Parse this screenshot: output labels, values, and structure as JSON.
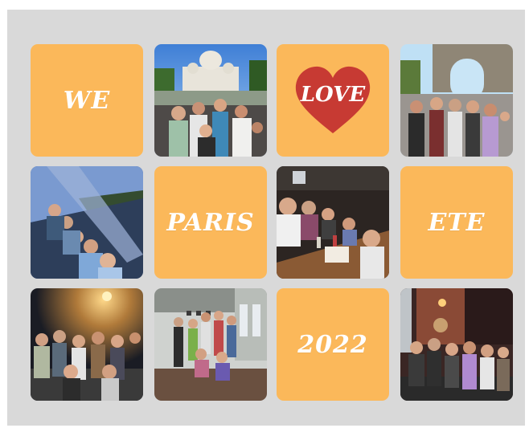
{
  "collage": {
    "words": {
      "we": "WE",
      "love": "LOVE",
      "paris": "PARIS",
      "ete": "ETE",
      "year": "2022"
    },
    "colors": {
      "background": "#d9d9d9",
      "tile": "#fbb85a",
      "heart": "#c73a33",
      "text": "#ffffff"
    },
    "photos": [
      "group-photo-sacre-coeur",
      "group-photo-arc-de-triomphe",
      "group-photo-boat-tour",
      "group-photo-restaurant",
      "group-photo-night-street",
      "group-photo-indoor-hall",
      "group-photo-pub"
    ]
  }
}
